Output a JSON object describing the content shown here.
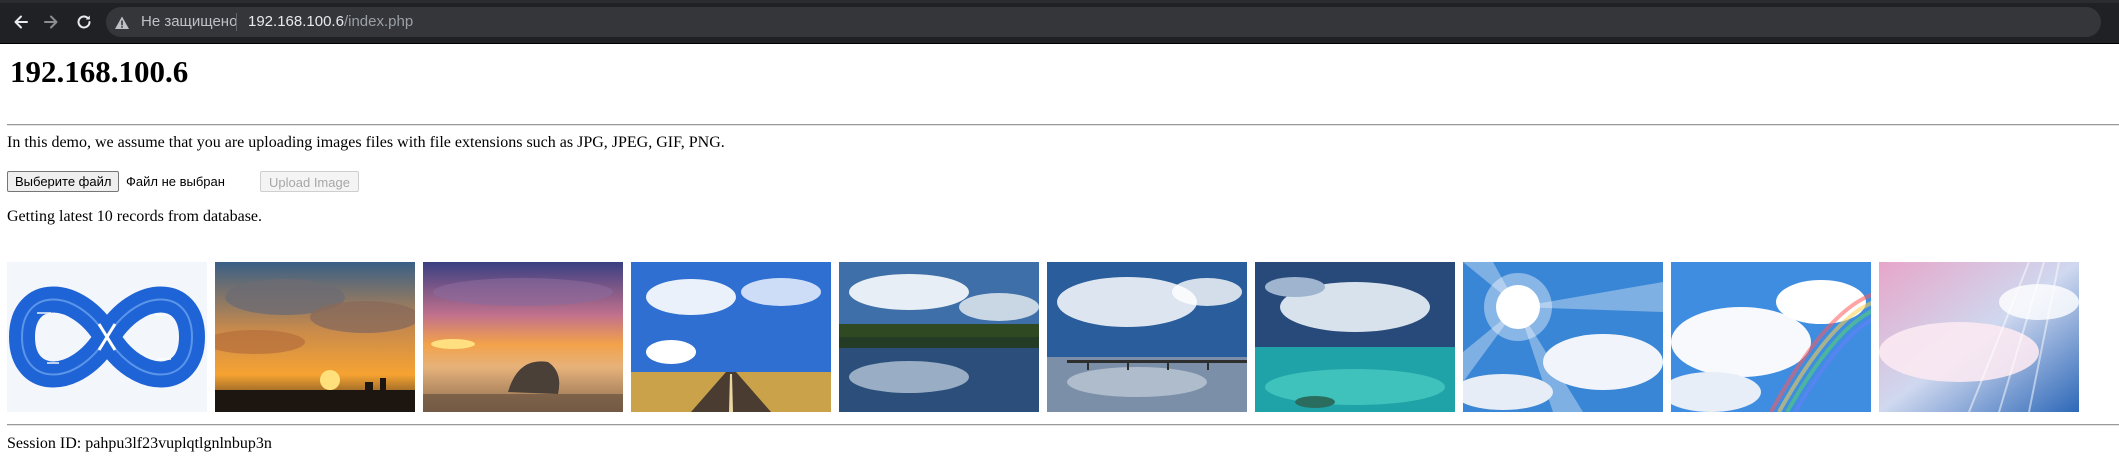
{
  "browser": {
    "security_label": "Не защищено",
    "url_host": "192.168.100.6",
    "url_path": "/index.php"
  },
  "page": {
    "title": "192.168.100.6",
    "intro": "In this demo, we assume that you are uploading images files with file extensions such as JPG, JPEG, GIF, PNG.",
    "file_button_label": "Выберите файл",
    "file_status": "Файл не выбран",
    "upload_button_label": "Upload Image",
    "records_text": "Getting latest 10 records from database.",
    "session_text": "Session ID: pahpu3lf23vuplqtlgnlnbup3n"
  },
  "gallery": {
    "images": [
      {
        "name": "infinity-loop-diagram-image"
      },
      {
        "name": "sunset-city-skyline-image"
      },
      {
        "name": "beach-sunset-rock-image"
      },
      {
        "name": "road-blue-sky-clouds-image"
      },
      {
        "name": "lake-reflection-clouds-image"
      },
      {
        "name": "pier-cloud-reflection-image"
      },
      {
        "name": "turquoise-sea-clouds-image"
      },
      {
        "name": "sun-rays-clouds-image"
      },
      {
        "name": "rainbow-clouds-image"
      },
      {
        "name": "pink-blue-clouds-image"
      }
    ]
  },
  "colors": {
    "chrome_bg": "#202124",
    "address_bar_bg": "#35363a",
    "sky_blue": "#2f6fd1"
  }
}
